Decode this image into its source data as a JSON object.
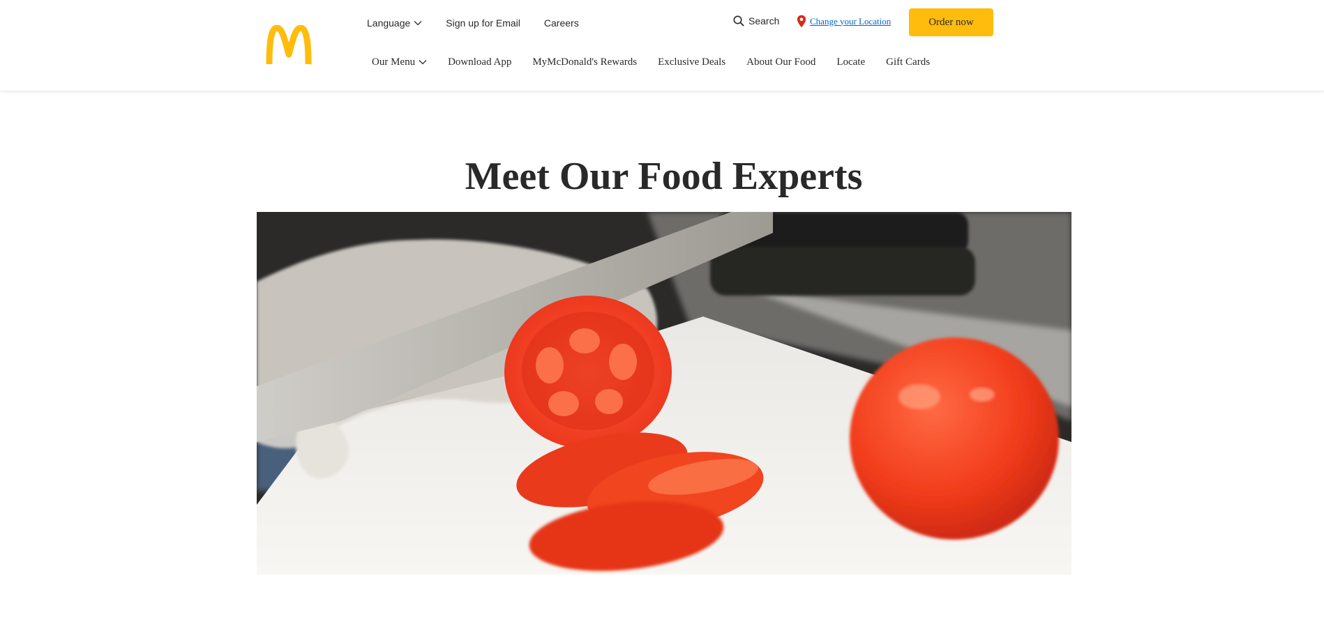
{
  "brand": {
    "logo_color": "#ffbc0d",
    "name": "McDonald's"
  },
  "utility_nav": {
    "language_label": "Language",
    "email_label": "Sign up for Email",
    "careers_label": "Careers"
  },
  "search": {
    "label": "Search",
    "icon": "search-icon"
  },
  "location": {
    "label": "Change your Location",
    "icon": "map-pin-icon",
    "pin_color": "#da291c"
  },
  "order": {
    "label": "Order now",
    "color": "#ffbc0d"
  },
  "main_nav": {
    "items": [
      {
        "label": "Our Menu",
        "has_dropdown": true
      },
      {
        "label": "Download App"
      },
      {
        "label": "MyMcDonald's Rewards"
      },
      {
        "label": "Exclusive Deals"
      },
      {
        "label": "About Our Food"
      },
      {
        "label": "Locate"
      },
      {
        "label": "Gift Cards"
      }
    ]
  },
  "main": {
    "title": "Meet Our Food Experts",
    "hero_image": "tomato-slicing-photo"
  }
}
